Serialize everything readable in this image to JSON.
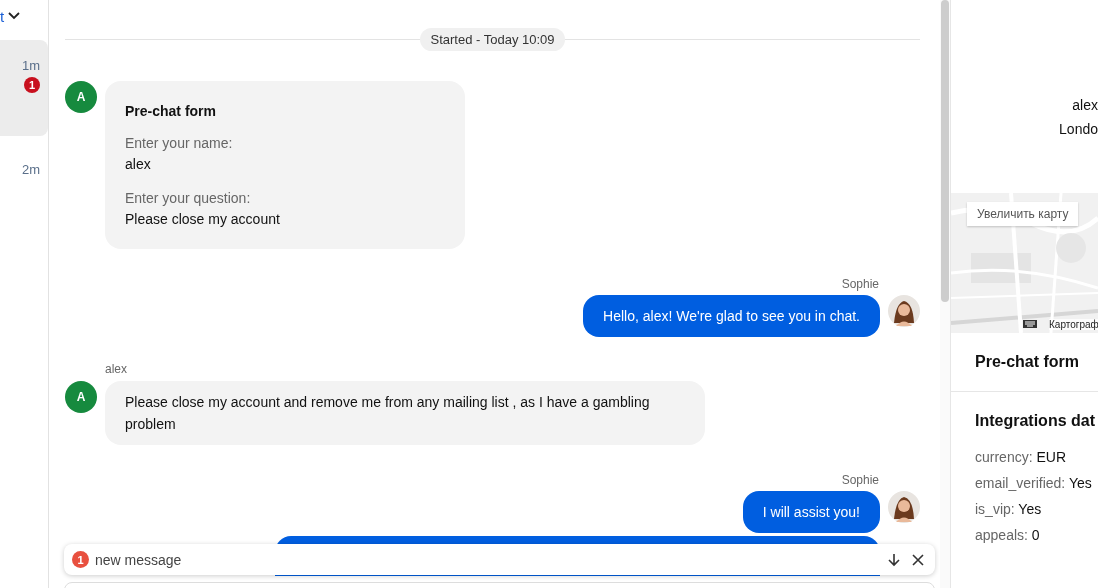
{
  "sidebar": {
    "header_text": "t",
    "items": [
      {
        "time": "1m",
        "badge": "1",
        "selected": true
      },
      {
        "time": "2m",
        "selected": false
      }
    ]
  },
  "chat": {
    "started": "Started - Today 10:09",
    "messages": [
      {
        "kind": "form",
        "avatar": "A",
        "title": "Pre-chat form",
        "fields": [
          {
            "label": "Enter your name:",
            "value": "alex"
          },
          {
            "label": "Enter your question:",
            "value": "Please close my account"
          }
        ]
      },
      {
        "kind": "agent",
        "author": "Sophie",
        "text": "Hello, alex! We're glad to see you in chat."
      },
      {
        "kind": "visitor",
        "author": "alex",
        "avatar": "A",
        "text": "Please close my account and remove me from any mailing list , as I have a gambling problem"
      },
      {
        "kind": "agent",
        "author": "Sophie",
        "text": "I will assist you!"
      },
      {
        "kind": "partial"
      }
    ]
  },
  "new_message_bar": {
    "count": "1",
    "text": "new message"
  },
  "right_panel": {
    "name": "alex",
    "location": "Londo",
    "map": {
      "kind": "picture",
      "zoom_button": "Увеличить карту",
      "attribution": "Картограф"
    },
    "sections": [
      {
        "title": "Pre-chat form"
      },
      {
        "title": "Integrations dat",
        "fields": [
          {
            "key": "currency:",
            "value": "EUR"
          },
          {
            "key": "email_verified:",
            "value": "Yes"
          },
          {
            "key": "is_vip:",
            "value": "Yes"
          },
          {
            "key": "appeals:",
            "value": "0"
          }
        ]
      }
    ]
  }
}
